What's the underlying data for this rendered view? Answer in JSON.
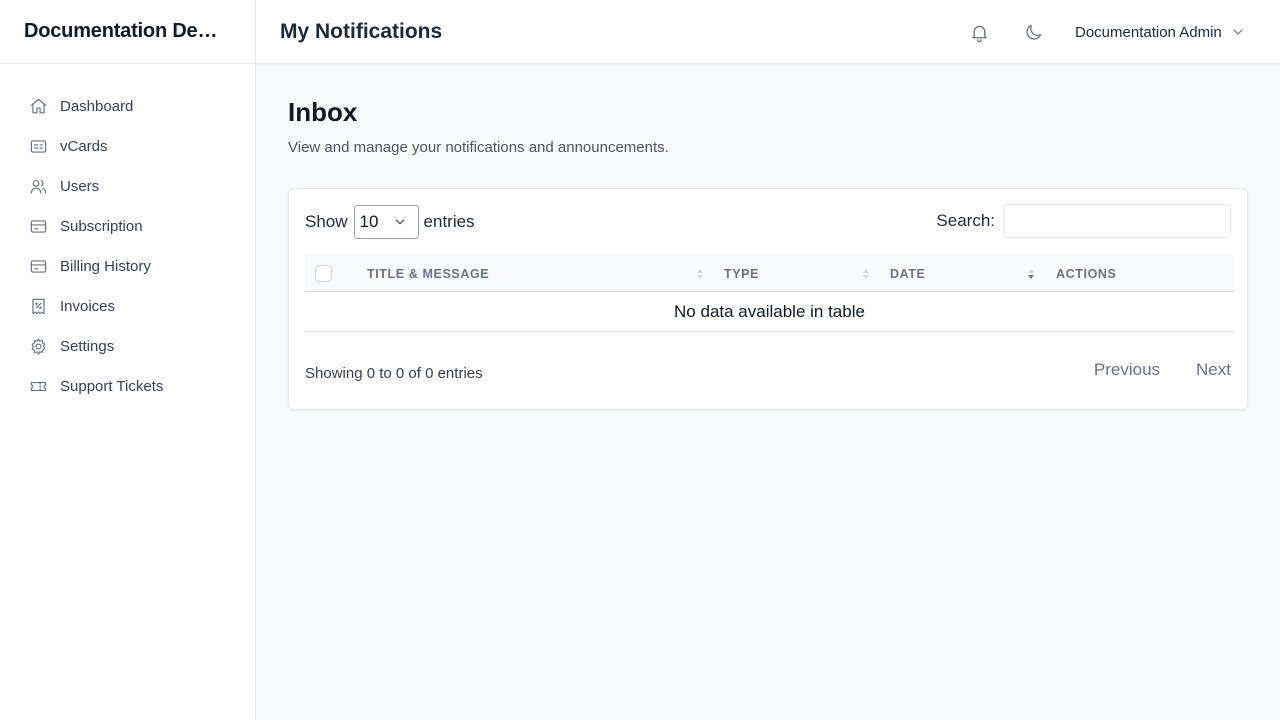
{
  "sidebar": {
    "brand": "Documentation Demo",
    "items": [
      {
        "label": "Dashboard",
        "icon": "home-icon"
      },
      {
        "label": "vCards",
        "icon": "id-card-icon"
      },
      {
        "label": "Users",
        "icon": "users-icon"
      },
      {
        "label": "Subscription",
        "icon": "credit-card-icon"
      },
      {
        "label": "Billing History",
        "icon": "credit-card-icon"
      },
      {
        "label": "Invoices",
        "icon": "receipt-icon"
      },
      {
        "label": "Settings",
        "icon": "gear-icon"
      },
      {
        "label": "Support Tickets",
        "icon": "ticket-icon"
      }
    ]
  },
  "header": {
    "title": "My Notifications",
    "user_name": "Documentation Admin"
  },
  "main": {
    "heading": "Inbox",
    "subheading": "View and manage your notifications and announcements."
  },
  "table": {
    "show_label": "Show",
    "entries_label": "entries",
    "page_length": "10",
    "search_label": "Search:",
    "search_value": "",
    "columns": [
      "TITLE & MESSAGE",
      "TYPE",
      "DATE",
      "ACTIONS"
    ],
    "empty_message": "No data available in table",
    "info": "Showing 0 to 0 of 0 entries",
    "prev_label": "Previous",
    "next_label": "Next"
  },
  "colors": {
    "text_primary": "#111827",
    "text_muted": "#6b7280",
    "border": "#e5e7eb",
    "background": "#f9fafb"
  }
}
